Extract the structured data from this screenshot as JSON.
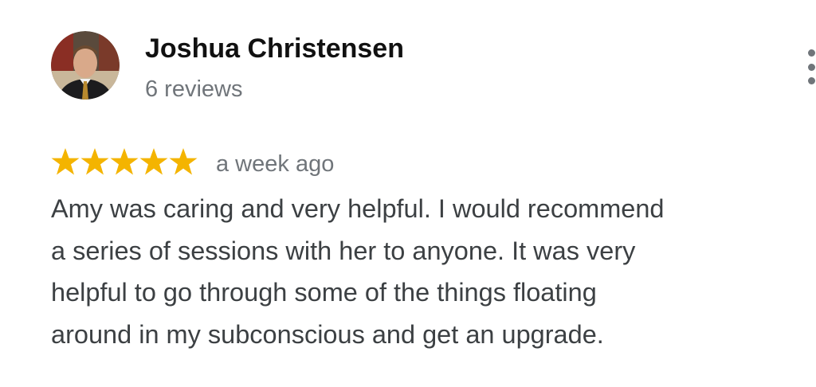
{
  "review": {
    "author": {
      "name": "Joshua Christensen",
      "review_count": "6 reviews",
      "avatar": "profile-photo"
    },
    "rating": {
      "stars": 5,
      "max": 5,
      "color": "#f4b400"
    },
    "time_ago": "a week ago",
    "text": "Amy was caring and very helpful.  I would recommend\na series of sessions with her to anyone.  It was very\nhelpful to go through some of the things floating\naround in my subconscious and get an upgrade."
  },
  "menu": {
    "icon": "more-vertical-icon"
  },
  "colors": {
    "name": "#111111",
    "secondary": "#70757a",
    "body_text": "#3c4043"
  }
}
